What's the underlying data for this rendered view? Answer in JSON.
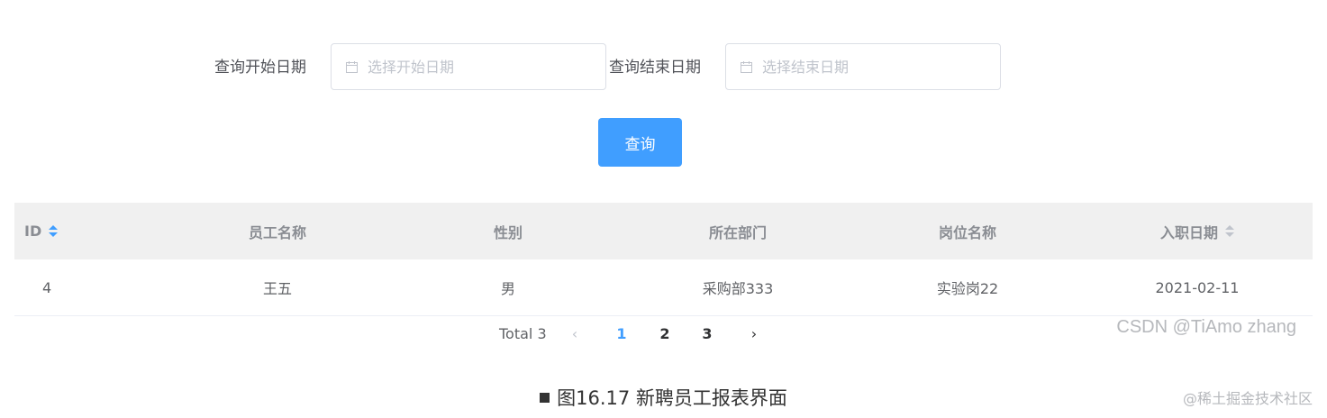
{
  "filter": {
    "start_label": "查询开始日期",
    "start_placeholder": "选择开始日期",
    "end_label": "查询结束日期",
    "end_placeholder": "选择结束日期",
    "query_button": "查询"
  },
  "table": {
    "columns": [
      "ID",
      "员工名称",
      "性别",
      "所在部门",
      "岗位名称",
      "入职日期"
    ],
    "rows": [
      [
        "4",
        "王五",
        "男",
        "采购部333",
        "实验岗22",
        "2021-02-11"
      ]
    ]
  },
  "pagination": {
    "total": "Total 3",
    "prev": "‹",
    "pages": [
      "1",
      "2",
      "3"
    ],
    "active_page": "1",
    "next": "›"
  },
  "watermark": "CSDN @TiAmo zhang",
  "caption": "图16.17 新聘员工报表界面",
  "site_watermark": "@稀土掘金技术社区",
  "colors": {
    "primary": "#409eff",
    "header_bg": "#f0f0f0",
    "border": "#dcdfe6"
  },
  "icons": {
    "date_input": "calendar-icon",
    "sort": "sort-caret-icon"
  }
}
